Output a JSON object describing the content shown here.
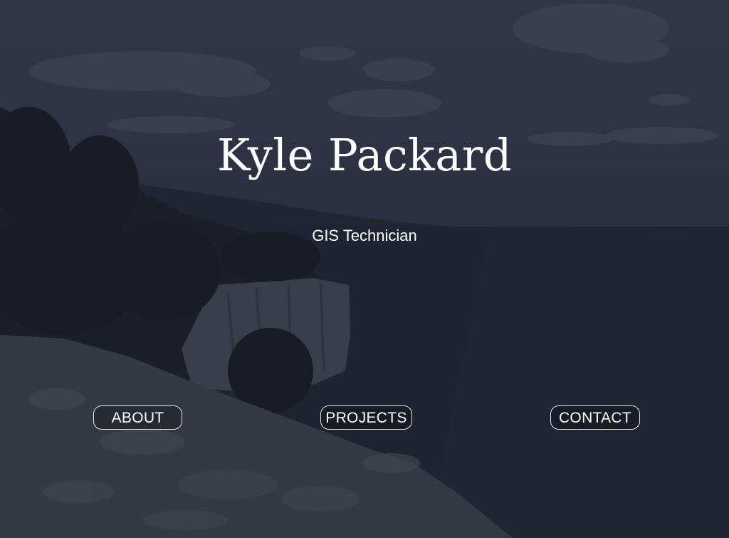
{
  "hero": {
    "name": "Kyle Packard",
    "role": "GIS Technician"
  },
  "nav": {
    "about": "ABOUT",
    "projects": "PROJECTS",
    "contact": "CONTACT"
  },
  "colors": {
    "overlay": "#2c303d",
    "text": "#ffffff",
    "button_border": "#e6e6e6"
  }
}
